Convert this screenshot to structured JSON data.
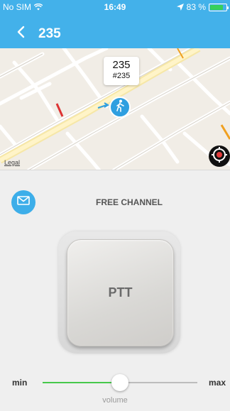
{
  "status_bar": {
    "carrier": "No SIM",
    "time": "16:49",
    "battery": "83 %",
    "battery_level": 0.83
  },
  "nav": {
    "title": "235"
  },
  "map": {
    "callout_title": "235",
    "callout_subtitle": "#235",
    "legal_label": "Legal"
  },
  "channel": {
    "label": "FREE CHANNEL"
  },
  "ptt": {
    "label": "PTT"
  },
  "volume": {
    "min_label": "min",
    "max_label": "max",
    "caption": "volume",
    "level": 0.5
  },
  "colors": {
    "header": "#43b1ea",
    "accent": "#3daee9",
    "volume_fill": "#46c84b",
    "background": "#efefef"
  },
  "icons": {
    "back": "chevron-left-icon",
    "message": "envelope-icon",
    "user_marker": "walking-person-icon",
    "locate": "target-icon"
  }
}
